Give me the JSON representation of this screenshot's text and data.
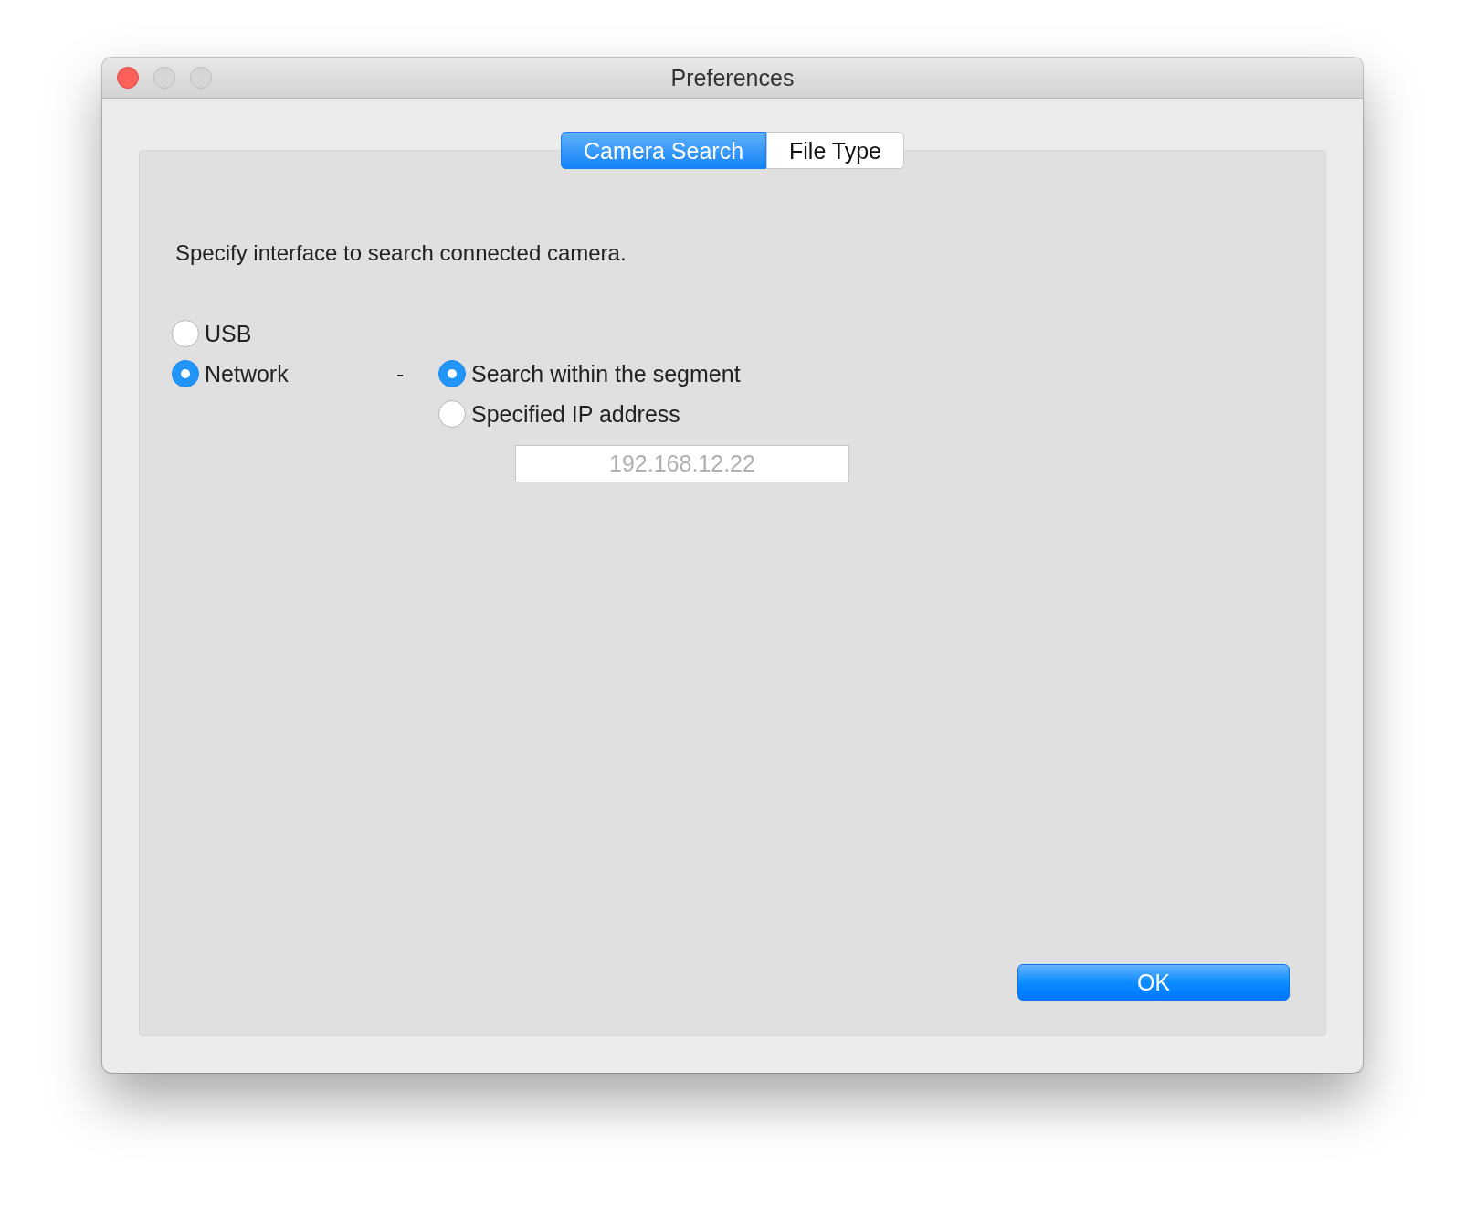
{
  "window": {
    "title": "Preferences"
  },
  "tabs": [
    {
      "label": "Camera Search",
      "selected": true
    },
    {
      "label": "File Type",
      "selected": false
    }
  ],
  "instruction": "Specify interface to search connected camera.",
  "interfaces": [
    {
      "label": "USB",
      "selected": false
    },
    {
      "label": "Network",
      "selected": true,
      "separator": "-",
      "options": [
        {
          "label": "Search within the segment",
          "selected": true
        },
        {
          "label": "Specified IP address",
          "selected": false
        }
      ]
    }
  ],
  "ip_field": {
    "value": "192.168.12.22",
    "disabled": true
  },
  "buttons": [
    "OK"
  ]
}
